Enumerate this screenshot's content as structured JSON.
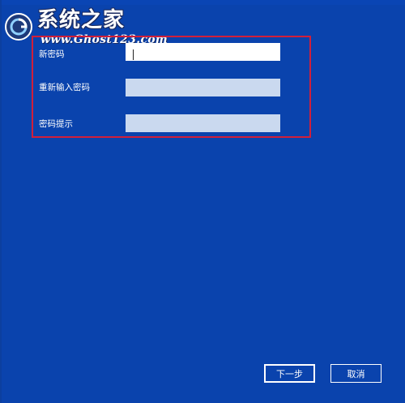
{
  "watermark": {
    "brand": "系统之家",
    "url": "www.Ghost123.com"
  },
  "form": {
    "new_password_label": "新密码",
    "new_password_value": "",
    "confirm_password_label": "重新输入密码",
    "confirm_password_value": "",
    "hint_label": "密码提示",
    "hint_value": ""
  },
  "buttons": {
    "next_label": "下一步",
    "cancel_label": "取消"
  },
  "colors": {
    "background": "#0a43ad",
    "highlight_border": "#d11f3a",
    "inactive_field": "#cad9ef"
  }
}
